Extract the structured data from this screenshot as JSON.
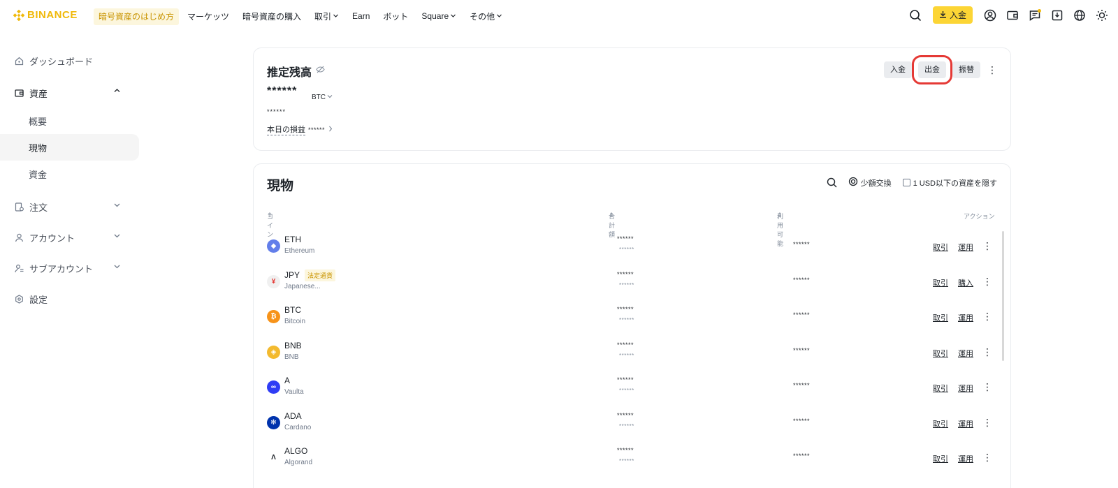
{
  "nav": {
    "logo": "BINANCE",
    "promo": "暗号資産のはじめ方",
    "items": [
      {
        "label": "マーケッツ",
        "chevron": false
      },
      {
        "label": "暗号資産の購入",
        "chevron": false
      },
      {
        "label": "取引",
        "chevron": true
      },
      {
        "label": "Earn",
        "chevron": false
      },
      {
        "label": "ボット",
        "chevron": false
      },
      {
        "label": "Square",
        "chevron": true
      },
      {
        "label": "その他",
        "chevron": true
      }
    ],
    "deposit": "入金",
    "accent": "#f0b90b"
  },
  "sidebar": {
    "dashboard": "ダッシュボード",
    "assets": "資産",
    "overview": "概要",
    "spot": "現物",
    "funding": "資金",
    "orders": "注文",
    "account": "アカウント",
    "subaccount": "サブアカウント",
    "settings": "設定"
  },
  "balance": {
    "title": "推定残高",
    "amount": "******",
    "unit": "BTC",
    "sub": "******",
    "pnl_label": "本日の損益",
    "pnl_value": "******",
    "deposit": "入金",
    "withdraw": "出金",
    "transfer": "振替"
  },
  "spot": {
    "title": "現物",
    "small_exchange": "少額交換",
    "hide_small": "1 USD以下の資産を隠す",
    "columns": {
      "coin": "コイン",
      "total": "合計額",
      "available": "利用可能",
      "action": "アクション"
    },
    "rows": [
      {
        "symbol": "ETH",
        "name": "Ethereum",
        "total": "******",
        "total_sub": "******",
        "available": "******",
        "a1": "取引",
        "a2": "運用",
        "badge": "",
        "icon_char": "◆",
        "icon_color": "#627eea"
      },
      {
        "symbol": "JPY",
        "name": "Japanese...",
        "total": "******",
        "total_sub": "******",
        "available": "******",
        "a1": "取引",
        "a2": "購入",
        "badge": "法定通貨",
        "icon_char": "¥",
        "icon_color": "#f0f0f0"
      },
      {
        "symbol": "BTC",
        "name": "Bitcoin",
        "total": "******",
        "total_sub": "******",
        "available": "******",
        "a1": "取引",
        "a2": "運用",
        "badge": "",
        "icon_char": "₿",
        "icon_color": "#f7931a"
      },
      {
        "symbol": "BNB",
        "name": "BNB",
        "total": "******",
        "total_sub": "******",
        "available": "******",
        "a1": "取引",
        "a2": "運用",
        "badge": "",
        "icon_char": "◈",
        "icon_color": "#f3ba2f"
      },
      {
        "symbol": "A",
        "name": "Vaulta",
        "total": "******",
        "total_sub": "******",
        "available": "******",
        "a1": "取引",
        "a2": "運用",
        "badge": "",
        "icon_char": "∞",
        "icon_color": "#2f3df5"
      },
      {
        "symbol": "ADA",
        "name": "Cardano",
        "total": "******",
        "total_sub": "******",
        "available": "******",
        "a1": "取引",
        "a2": "運用",
        "badge": "",
        "icon_char": "✻",
        "icon_color": "#0033ad"
      },
      {
        "symbol": "ALGO",
        "name": "Algorand",
        "total": "******",
        "total_sub": "******",
        "available": "******",
        "a1": "取引",
        "a2": "運用",
        "badge": "",
        "icon_char": "Λ",
        "icon_color": "#ffffff"
      }
    ]
  }
}
